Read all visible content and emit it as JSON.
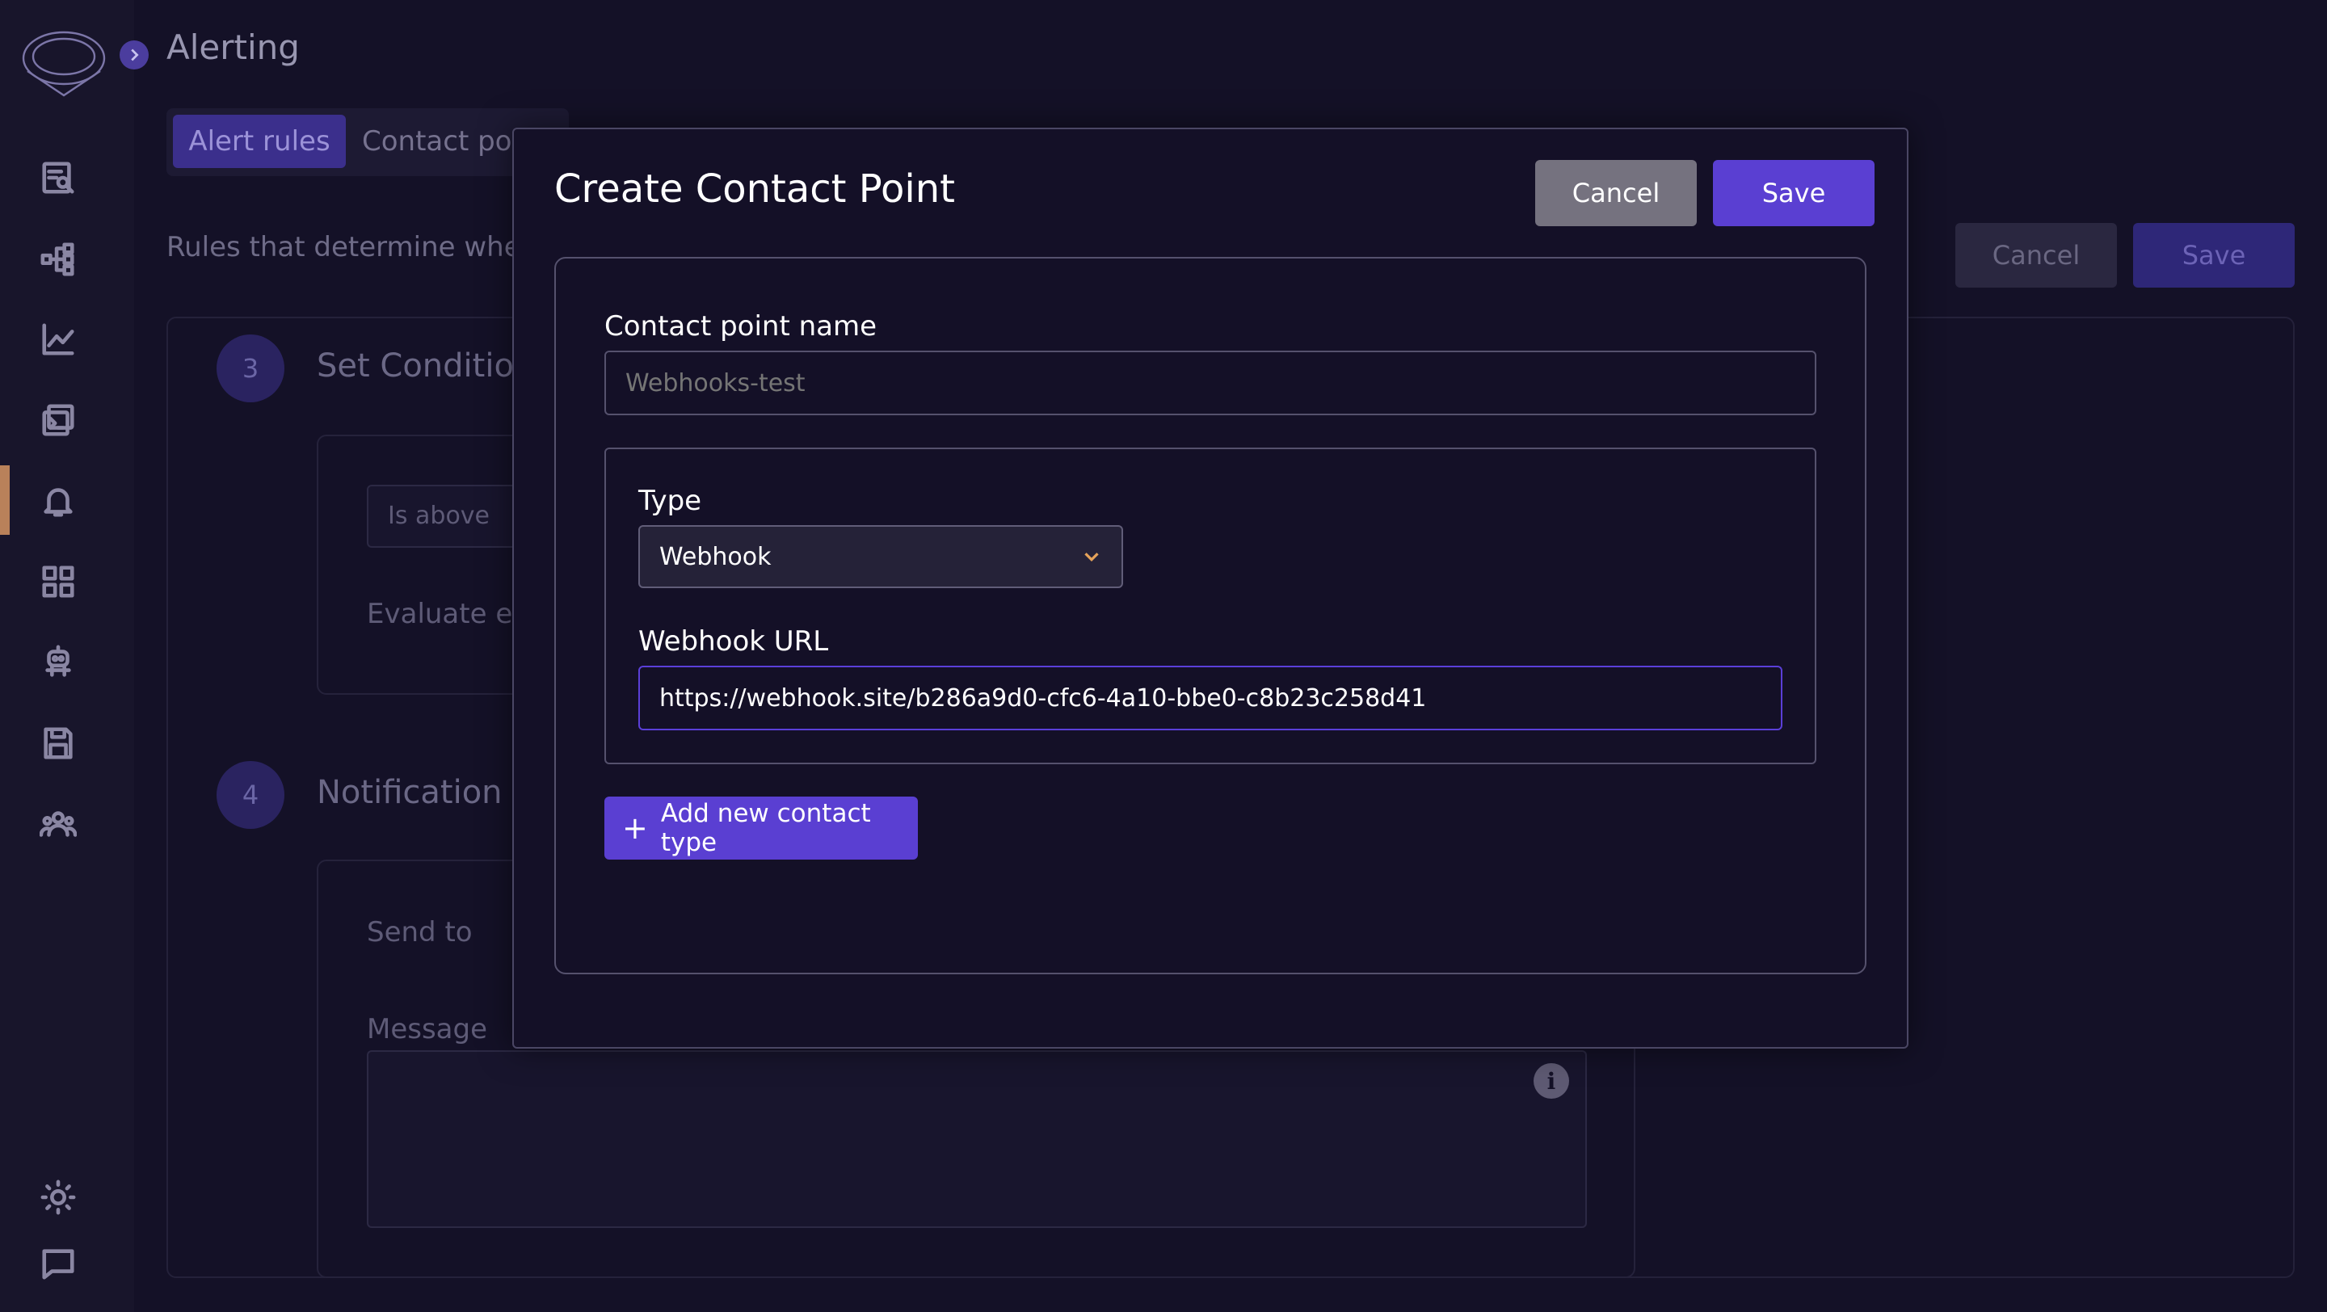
{
  "page": {
    "title": "Alerting",
    "subtitle": "Rules that determine whet",
    "tabs": [
      {
        "label": "Alert rules"
      },
      {
        "label": "Contact poi"
      }
    ],
    "cancel_label": "Cancel",
    "save_label": "Save"
  },
  "sidebar": {
    "items": [
      {
        "icon": "query-icon"
      },
      {
        "icon": "graph-icon"
      },
      {
        "icon": "chart-icon"
      },
      {
        "icon": "terminal-icon"
      },
      {
        "icon": "bell-icon",
        "active": true
      },
      {
        "icon": "grid-icon"
      },
      {
        "icon": "robot-icon"
      },
      {
        "icon": "save-icon"
      },
      {
        "icon": "users-icon"
      }
    ],
    "bottom": [
      {
        "icon": "sun-icon"
      },
      {
        "icon": "chat-icon"
      }
    ]
  },
  "rule": {
    "steps": [
      {
        "number": "3",
        "title": "Set Condition",
        "condition": "Is above",
        "evaluate_label": "Evaluate ev"
      },
      {
        "number": "4",
        "title": "Notification",
        "send_to_label": "Send to",
        "message_label": "Message"
      }
    ]
  },
  "modal": {
    "title": "Create Contact Point",
    "cancel_label": "Cancel",
    "save_label": "Save",
    "name_label": "Contact point name",
    "name_value": "",
    "name_placeholder": "Webhooks-test",
    "type_label": "Type",
    "type_value": "Webhook",
    "url_label": "Webhook URL",
    "url_value": "https://webhook.site/b286a9d0-cfc6-4a10-bbe0-c8b23c258d41",
    "add_button_label": "Add new contact type"
  },
  "colors": {
    "background": "#141127",
    "accent": "#5a3fd2",
    "active_marker": "#b9815a",
    "muted_button": "#75727f"
  }
}
